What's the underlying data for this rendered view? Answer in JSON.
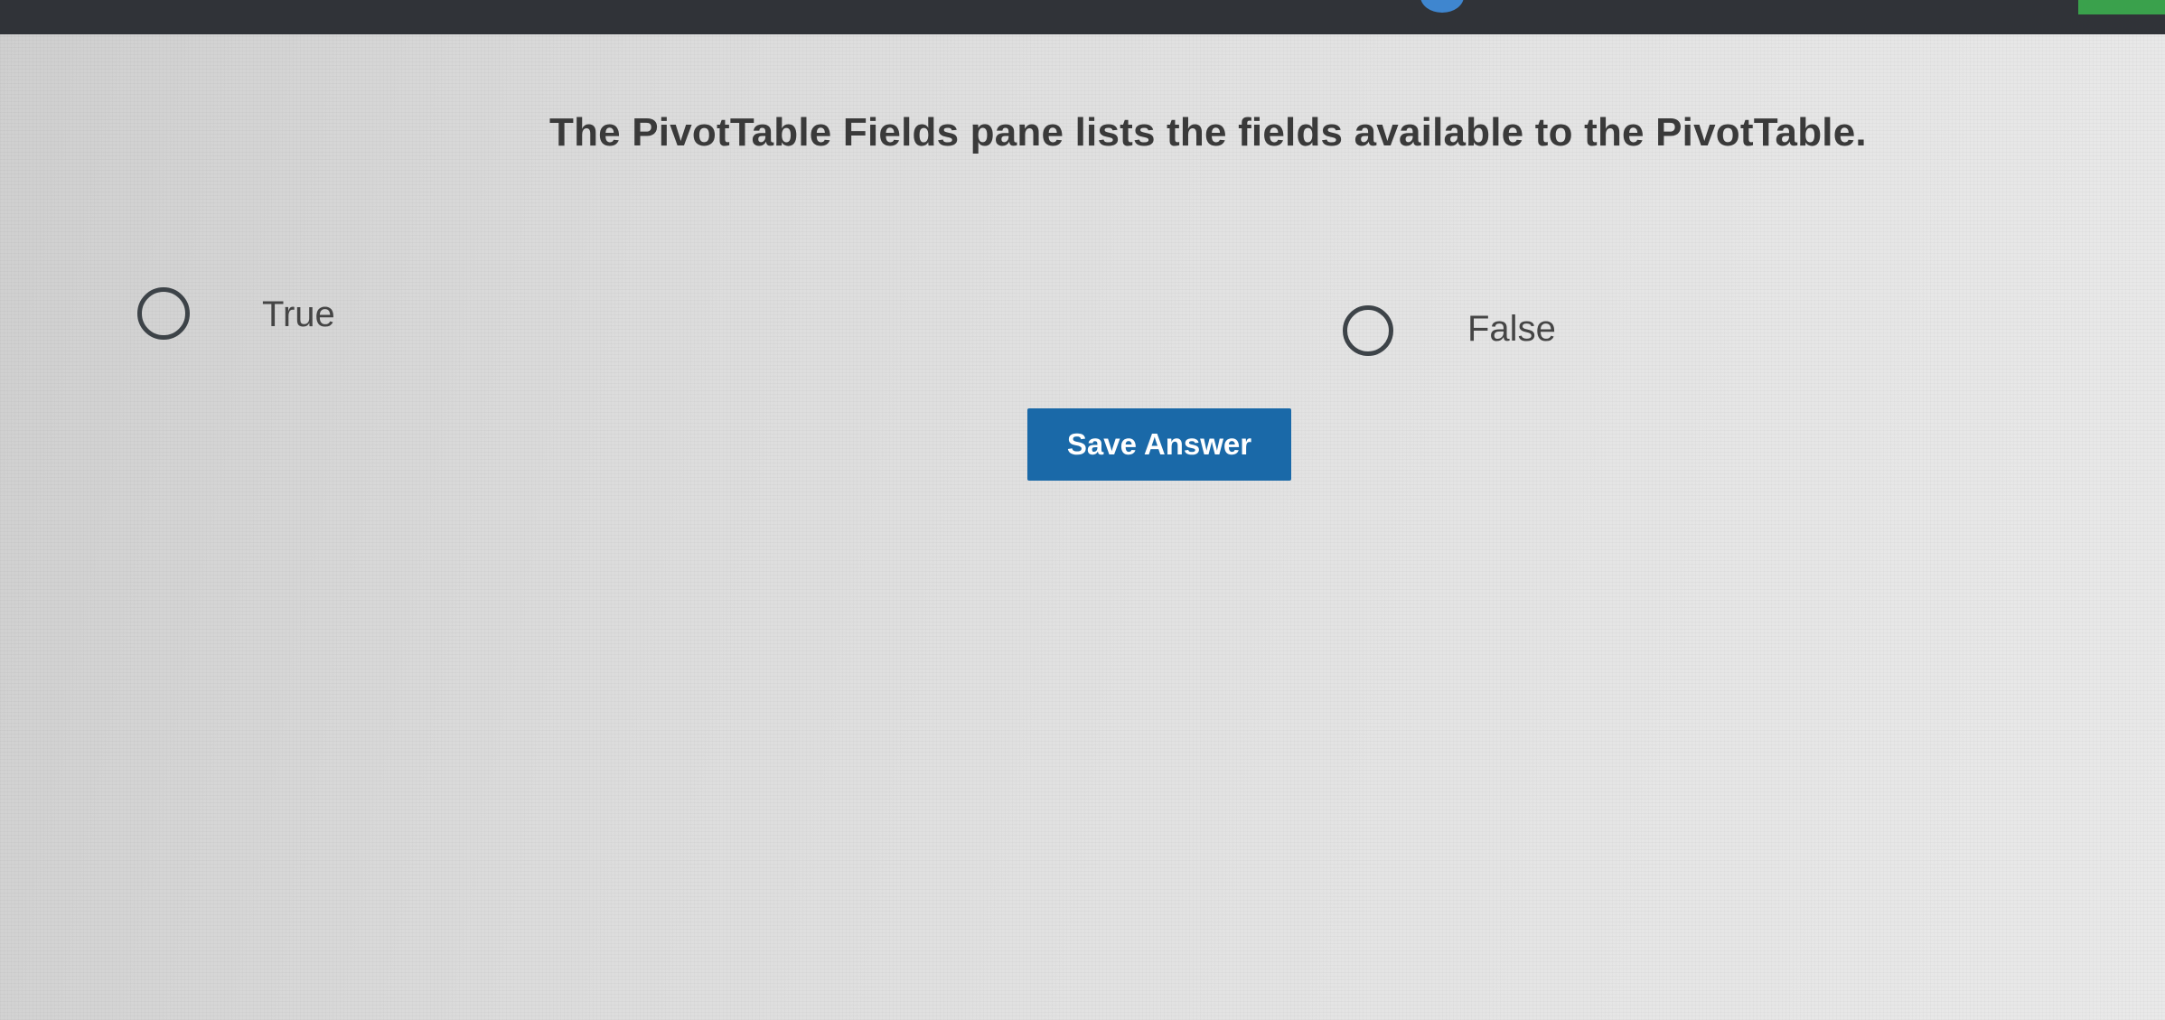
{
  "question": {
    "text": "The PivotTable Fields pane lists the fields available to the PivotTable."
  },
  "options": [
    {
      "label": "True",
      "selected": false
    },
    {
      "label": "False",
      "selected": false
    }
  ],
  "actions": {
    "save_label": "Save Answer"
  },
  "colors": {
    "header_bar": "#303338",
    "header_badge": "#3f86cf",
    "header_green": "#3aa14c",
    "primary_button": "#1a69a8"
  }
}
